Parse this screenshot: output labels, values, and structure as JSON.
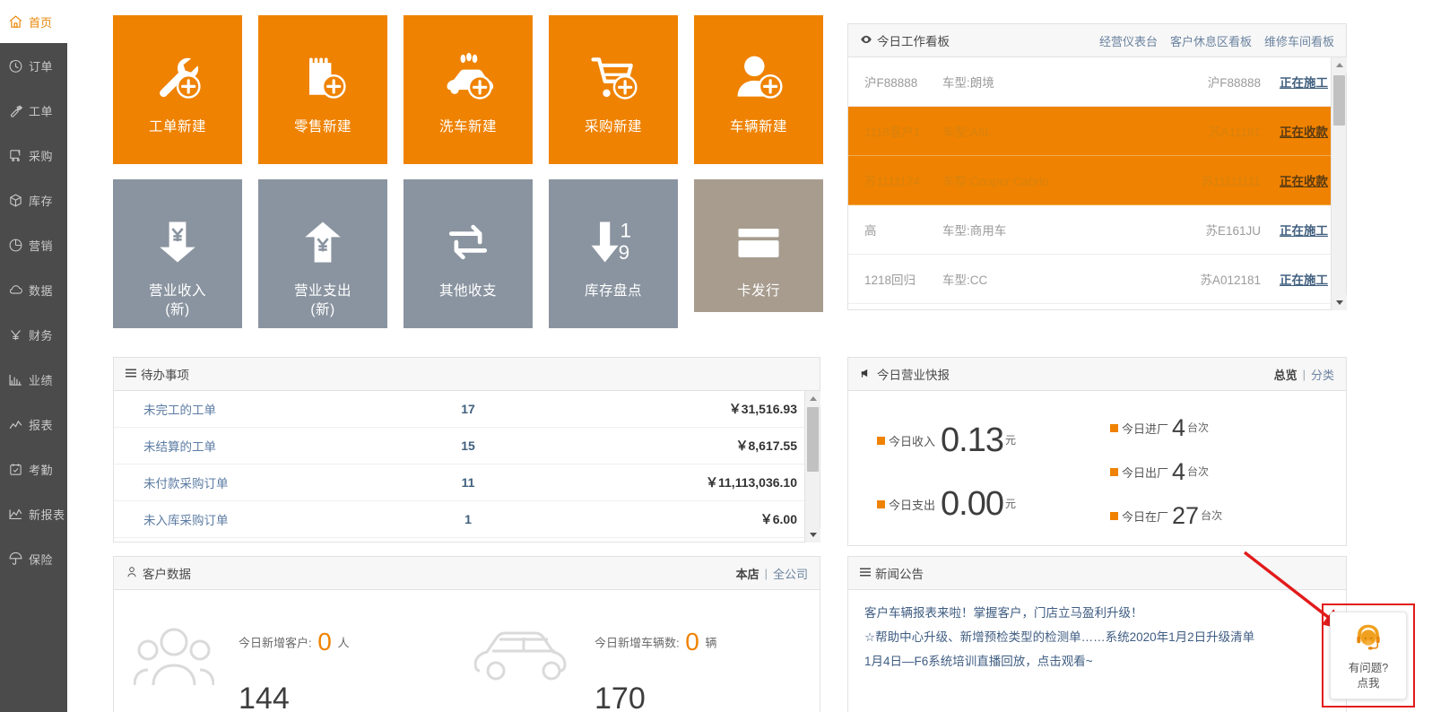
{
  "sidebar": {
    "home": {
      "label": "首页",
      "icon": "home-icon"
    },
    "items": [
      {
        "label": "订单",
        "icon": "clock-order-icon"
      },
      {
        "label": "工单",
        "icon": "wrench-icon"
      },
      {
        "label": "采购",
        "icon": "cart-purchase-icon"
      },
      {
        "label": "库存",
        "icon": "box-icon"
      },
      {
        "label": "营销",
        "icon": "pie-chart-icon"
      },
      {
        "label": "数据",
        "icon": "cloud-icon"
      },
      {
        "label": "财务",
        "icon": "yen-icon"
      },
      {
        "label": "业绩",
        "icon": "bar-chart-icon"
      },
      {
        "label": "报表",
        "icon": "line-chart-icon"
      },
      {
        "label": "考勤",
        "icon": "calendar-check-icon"
      },
      {
        "label": "新报表",
        "icon": "line-chart-new-icon"
      },
      {
        "label": "保险",
        "icon": "umbrella-icon"
      }
    ]
  },
  "tiles": {
    "row1": [
      {
        "label": "工单新建",
        "icon": "wrench-plus-icon",
        "color": "#ef8200"
      },
      {
        "label": "零售新建",
        "icon": "retail-plus-icon",
        "color": "#ef8200"
      },
      {
        "label": "洗车新建",
        "icon": "carwash-plus-icon",
        "color": "#ef8200"
      },
      {
        "label": "采购新建",
        "icon": "cart-plus-icon",
        "color": "#ef8200"
      },
      {
        "label": "车辆新建",
        "icon": "user-plus-icon",
        "color": "#ef8200"
      }
    ],
    "row2": [
      {
        "label": "营业收入\n(新)",
        "line1": "营业收入",
        "line2": "(新)",
        "icon": "yen-arrow-down-icon",
        "color": "#8a94a0"
      },
      {
        "label": "营业支出\n(新)",
        "line1": "营业支出",
        "line2": "(新)",
        "icon": "yen-arrow-up-icon",
        "color": "#8a94a0"
      },
      {
        "label": "其他收支",
        "line1": "其他收支",
        "line2": "",
        "icon": "exchange-icon",
        "color": "#8a94a0"
      },
      {
        "label": "库存盘点",
        "line1": "库存盘点",
        "line2": "",
        "icon": "stocktake-icon",
        "color": "#8a94a0"
      },
      {
        "label": "卡发行",
        "line1": "卡发行",
        "line2": "",
        "icon": "card-icon",
        "color": "#a79c8e"
      }
    ]
  },
  "workboard": {
    "title": "今日工作看板",
    "title_icon": "eye-icon",
    "links": [
      "经营仪表台",
      "客户休息区看板",
      "维修车间看板"
    ],
    "rows": [
      {
        "customer": "沪F88888",
        "model": "车型:朗境",
        "plate": "沪F88888",
        "status": "正在施工",
        "highlight": false
      },
      {
        "customer": "1118客户1",
        "model": "车型:A6L",
        "plate": "苏A11181",
        "status": "正在收款",
        "highlight": true
      },
      {
        "customer": "苏1111174",
        "model": "车型:Cooper Cabrio",
        "plate": "苏11111111",
        "status": "正在收款",
        "highlight": true
      },
      {
        "customer": "高",
        "model": "车型:商用车",
        "plate": "苏E161JU",
        "status": "正在施工",
        "highlight": false
      },
      {
        "customer": "1218回归",
        "model": "车型:CC",
        "plate": "苏A012181",
        "status": "正在施工",
        "highlight": false
      }
    ]
  },
  "todo": {
    "title": "待办事项",
    "title_icon": "list-icon",
    "rows": [
      {
        "label": "未完工的工单",
        "count": "17",
        "amount": "￥31,516.93"
      },
      {
        "label": "未结算的工单",
        "count": "15",
        "amount": "￥8,617.55"
      },
      {
        "label": "未付款采购订单",
        "count": "11",
        "amount": "￥11,113,036.10"
      },
      {
        "label": "未入库采购订单",
        "count": "1",
        "amount": "￥6.00"
      }
    ]
  },
  "bulletin": {
    "title": "今日营业快报",
    "title_icon": "megaphone-icon",
    "links": [
      "总览",
      "分类"
    ],
    "separator": "|",
    "left": [
      {
        "label": "今日收入",
        "value": "0.13",
        "unit": "元"
      },
      {
        "label": "今日支出",
        "value": "0.00",
        "unit": "元"
      }
    ],
    "right": [
      {
        "label": "今日进厂",
        "value": "4",
        "unit": "台次"
      },
      {
        "label": "今日出厂",
        "value": "4",
        "unit": "台次"
      },
      {
        "label": "今日在厂",
        "value": "27",
        "unit": "台次"
      }
    ]
  },
  "news": {
    "title": "新闻公告",
    "title_icon": "list-icon",
    "lines": [
      "客户车辆报表来啦！掌握客户，门店立马盈利升级！",
      "☆帮助中心升级、新增预检类型的检测单……系统2020年1月2日升级清单",
      "1月4日—F6系统培训直播回放，点击观看~"
    ]
  },
  "customer": {
    "title": "客户数据",
    "title_icon": "person-icon",
    "links": [
      "本店",
      "全公司"
    ],
    "separator": "|",
    "blocks": [
      {
        "icon": "people-icon",
        "label": "今日新增客户:",
        "value": "0",
        "unit": "人",
        "total_value": "144"
      },
      {
        "icon": "car-icon",
        "label": "今日新增车辆数:",
        "value": "0",
        "unit": "辆",
        "total_value": "170"
      }
    ]
  },
  "help": {
    "line1": "有问题?",
    "line2": "点我",
    "icon": "headset-agent-icon"
  },
  "colors": {
    "orange": "#ef8200",
    "gray_tile": "#8a94a0",
    "tan_tile": "#a79c8e",
    "sidebar": "#4b4b4b",
    "link_blue": "#6b83a0",
    "highlight_red": "#e21b1b"
  }
}
